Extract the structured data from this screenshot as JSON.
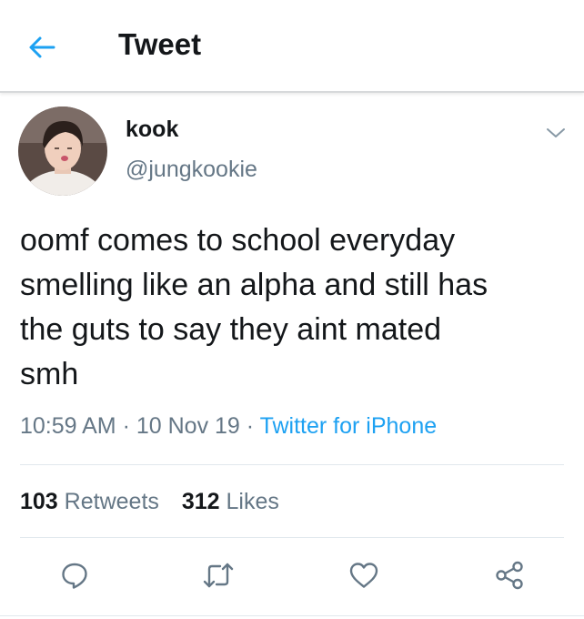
{
  "header": {
    "title": "Tweet"
  },
  "tweet": {
    "display_name": "kook",
    "handle": "@jungkookie",
    "text": "oomf comes to school everyday\nsmelling like an alpha and still has\nthe guts to say they aint mated\nsmh",
    "time": "10:59 AM",
    "date": "10 Nov 19",
    "separator": " · ",
    "source": "Twitter for iPhone"
  },
  "stats": {
    "retweets_count": "103",
    "retweets_label": "Retweets",
    "likes_count": "312",
    "likes_label": "Likes"
  },
  "icons": {
    "back": "arrow-left-icon",
    "caret": "chevron-down-icon",
    "reply": "reply-icon",
    "retweet": "retweet-icon",
    "like": "heart-icon",
    "share": "share-icon"
  },
  "colors": {
    "accent": "#1da1f2",
    "text": "#14171a",
    "secondary": "#657786",
    "divider": "#e1e8ed"
  }
}
